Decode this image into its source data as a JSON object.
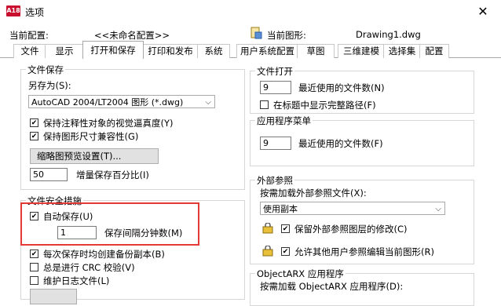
{
  "window": {
    "title": "选项",
    "app_icon": "A18"
  },
  "config_row": {
    "current_profile_label": "当前配置:",
    "current_profile_value": "<<未命名配置>>",
    "current_drawing_label": "当前图形:",
    "current_drawing_value": "Drawing1.dwg"
  },
  "tabs": [
    {
      "label": "文件"
    },
    {
      "label": "显示"
    },
    {
      "label": "打开和保存"
    },
    {
      "label": "打印和发布"
    },
    {
      "label": "系统"
    },
    {
      "label": "用户系统配置"
    },
    {
      "label": "草图"
    },
    {
      "label": "三维建模"
    },
    {
      "label": "选择集"
    },
    {
      "label": "配置"
    }
  ],
  "active_tab": "打开和保存",
  "file_save": {
    "group_title": "文件保存",
    "save_as_label": "另存为(S):",
    "save_as_value": "AutoCAD 2004/LT2004 图形 (*.dwg)",
    "maintain_visual_fidelity": "保持注释性对象的视觉逼真度(Y)",
    "maintain_drawing_size": "保持图形尺寸兼容性(G)",
    "thumbnail_button": "缩略图预览设置(T)...",
    "incremental_value": "50",
    "incremental_label": "增量保存百分比(I)"
  },
  "file_safety": {
    "group_title": "文件安全措施",
    "autosave_label": "自动保存(U)",
    "autosave_minutes_value": "1",
    "autosave_minutes_label": "保存间隔分钟数(M)",
    "backup_label": "每次保存时均创建备份副本(B)",
    "crc_label": "总是进行 CRC 校验(V)",
    "log_label": "维护日志文件(L)"
  },
  "file_open": {
    "group_title": "文件打开",
    "recent_files_value": "9",
    "recent_files_label": "最近使用的文件数(N)",
    "full_path_label": "在标题中显示完整路径(F)"
  },
  "app_menu": {
    "group_title": "应用程序菜单",
    "recent_files_value": "9",
    "recent_files_label": "最近使用的文件数(F)"
  },
  "xref": {
    "group_title": "外部参照",
    "demand_load_label": "按需加载外部参照文件(X):",
    "demand_load_value": "使用副本",
    "retain_changes_label": "保留外部参照图层的修改(C)",
    "allow_edit_label": "允许其他用户参照编辑当前图形(R)"
  },
  "objectarx": {
    "group_title": "ObjectARX 应用程序",
    "demand_load_label": "按需加载 ObjectARX 应用程序(D):"
  },
  "colors": {
    "highlight": "#e53935",
    "app_icon_red": "#c8102e"
  }
}
